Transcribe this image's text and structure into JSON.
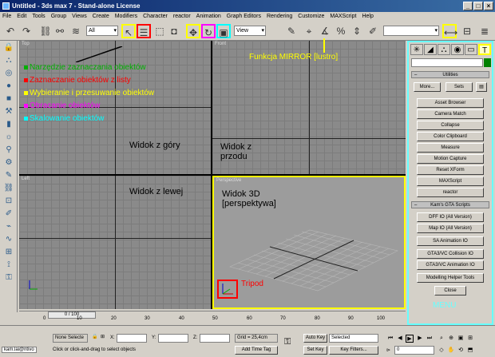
{
  "window": {
    "title": "Untitled - 3ds max 7 - Stand-alone License"
  },
  "menu": [
    "File",
    "Edit",
    "Tools",
    "Group",
    "Views",
    "Create",
    "Modifiers",
    "Character",
    "reactor",
    "Animation",
    "Graph Editors",
    "Rendering",
    "Customize",
    "MAXScript",
    "Help"
  ],
  "toolbar": {
    "selection_filter": "All",
    "ref_coord": "View"
  },
  "viewports": {
    "top": "Top",
    "front": "Front",
    "left": "Left",
    "perspective": "Perspective"
  },
  "annotations": {
    "select_tool": "Narzędzie zaznaczania obiektów",
    "select_by_name": "Zaznaczanie obiektów z listy",
    "select_move": "Wybieranie i przesuwanie obiektów",
    "select_rotate": "Obracanie obiektów",
    "scale": "Skalowanie obiektów",
    "mirror": "Funkcja MIRROR [lustro]",
    "view_top": "Widok z góry",
    "view_front": "Widok z przodu",
    "view_left": "Widok z lewej",
    "view_3d": "Widok 3D [perspektywa]",
    "tripod": "Tripod",
    "menu": "MENU"
  },
  "utilities": {
    "header": "Utilities",
    "more": "More...",
    "sets": "Sets",
    "items": [
      "Asset Browser",
      "Camera Match",
      "Collapse",
      "Color Clipboard",
      "Measure",
      "Motion Capture",
      "Reset XForm",
      "MAXScript",
      "reactor"
    ]
  },
  "gta": {
    "header": "Kam's GTA Scripts",
    "items": [
      "DFF IO (All Version)",
      "Map IO (All Version)",
      "SA Animation IO",
      "GTA3/VC Collision IO",
      "GTA3/VC Animation IO",
      "Modelling Helper Tools",
      "Close"
    ]
  },
  "timeline": {
    "slider": "0 / 100",
    "ticks": [
      "0",
      "10",
      "20",
      "30",
      "40",
      "50",
      "60",
      "70",
      "80",
      "90",
      "100"
    ]
  },
  "status": {
    "user": "kam.lai@ntivo",
    "selected": "None Selecte",
    "prompt": "Click or click-and-drag to select objects",
    "x_label": "X:",
    "y_label": "Y:",
    "z_label": "Z:",
    "grid": "Grid = 25,4cm",
    "add_time_tag": "Add Time Tag",
    "auto_key": "Auto Key",
    "key_mode": "Selected",
    "set_key": "Set Key",
    "key_filters": "Key Filters...",
    "frame": "0"
  },
  "colors": {
    "yellow": "#ffff00",
    "red": "#ff0000",
    "magenta": "#ff00ff",
    "cyan": "#00ffff",
    "green": "#008000"
  }
}
